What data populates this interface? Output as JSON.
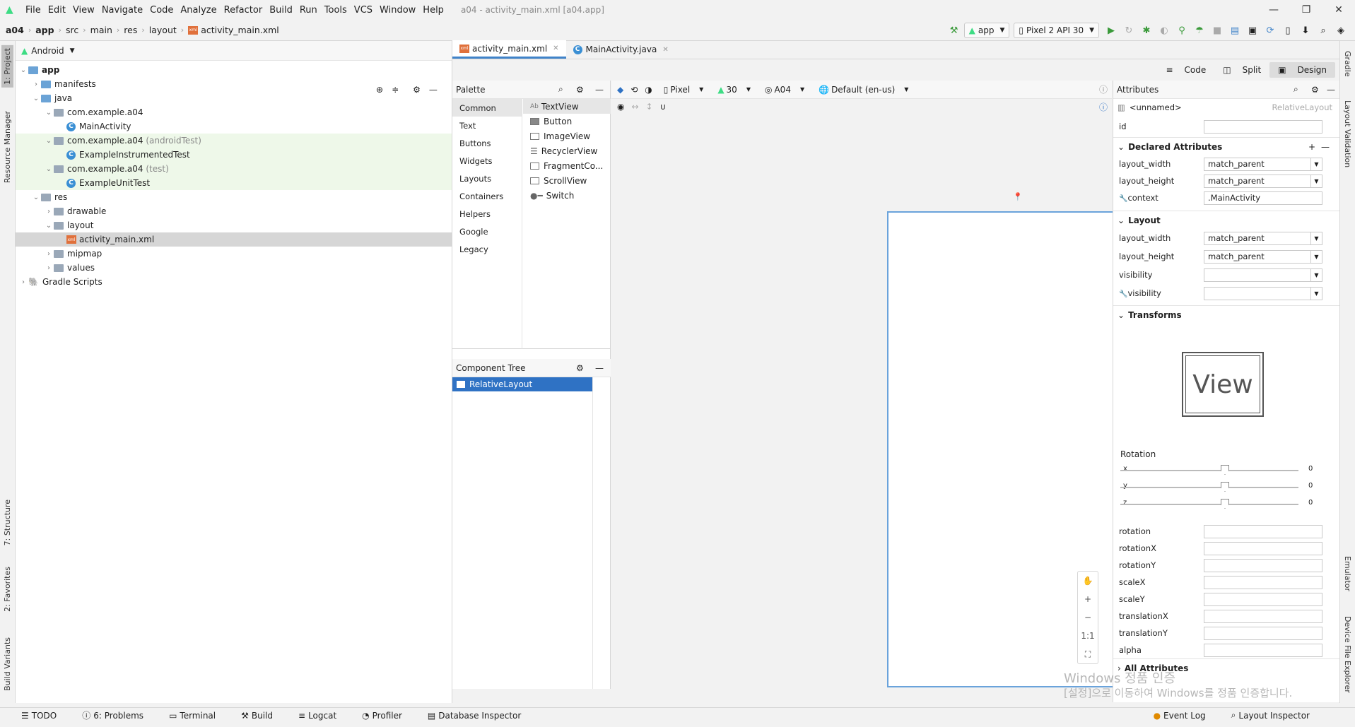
{
  "menu": [
    "File",
    "Edit",
    "View",
    "Navigate",
    "Code",
    "Analyze",
    "Refactor",
    "Build",
    "Run",
    "Tools",
    "VCS",
    "Window",
    "Help"
  ],
  "window_title": "a04 - activity_main.xml [a04.app]",
  "breadcrumb": [
    "a04",
    "app",
    "src",
    "main",
    "res",
    "layout",
    "activity_main.xml"
  ],
  "toolbar": {
    "run_config": "app",
    "device": "Pixel 2 API 30"
  },
  "left_tabs": {
    "project": "1: Project",
    "resource_manager": "Resource Manager",
    "structure": "7: Structure",
    "favorites": "2: Favorites",
    "build_variants": "Build Variants"
  },
  "right_tabs": {
    "gradle": "Gradle",
    "layout_validation": "Layout Validation",
    "emulator": "Emulator",
    "device_explorer": "Device File Explorer"
  },
  "project": {
    "view_label": "Android",
    "tree": [
      {
        "label": "app",
        "extra": ""
      },
      {
        "label": "manifests",
        "extra": ""
      },
      {
        "label": "java",
        "extra": ""
      },
      {
        "label": "com.example.a04",
        "extra": ""
      },
      {
        "label": "MainActivity",
        "extra": ""
      },
      {
        "label": "com.example.a04",
        "extra": "(androidTest)"
      },
      {
        "label": "ExampleInstrumentedTest",
        "extra": ""
      },
      {
        "label": "com.example.a04",
        "extra": "(test)"
      },
      {
        "label": "ExampleUnitTest",
        "extra": ""
      },
      {
        "label": "res",
        "extra": ""
      },
      {
        "label": "drawable",
        "extra": ""
      },
      {
        "label": "layout",
        "extra": ""
      },
      {
        "label": "activity_main.xml",
        "extra": ""
      },
      {
        "label": "mipmap",
        "extra": ""
      },
      {
        "label": "values",
        "extra": ""
      },
      {
        "label": "Gradle Scripts",
        "extra": ""
      }
    ]
  },
  "editor_tabs": [
    "activity_main.xml",
    "MainActivity.java"
  ],
  "view_modes": [
    "Code",
    "Split",
    "Design"
  ],
  "palette": {
    "title": "Palette",
    "categories": [
      "Common",
      "Text",
      "Buttons",
      "Widgets",
      "Layouts",
      "Containers",
      "Helpers",
      "Google",
      "Legacy"
    ],
    "items": [
      "TextView",
      "Button",
      "ImageView",
      "RecyclerView",
      "FragmentCo...",
      "ScrollView",
      "Switch"
    ]
  },
  "component_tree": {
    "title": "Component Tree",
    "root": "RelativeLayout"
  },
  "design_toolbar": {
    "device": "Pixel",
    "api": "30",
    "theme": "A04",
    "locale": "Default (en-us)"
  },
  "zoom": {
    "fit": "1:1"
  },
  "attributes": {
    "title": "Attributes",
    "component": "<unnamed>",
    "component_type": "RelativeLayout",
    "id_label": "id",
    "declared_title": "Declared Attributes",
    "declared": [
      {
        "k": "layout_width",
        "v": "match_parent"
      },
      {
        "k": "layout_height",
        "v": "match_parent"
      },
      {
        "k": "context",
        "v": ".MainActivity"
      }
    ],
    "layout_title": "Layout",
    "layout": [
      {
        "k": "layout_width",
        "v": "match_parent"
      },
      {
        "k": "layout_height",
        "v": "match_parent"
      },
      {
        "k": "visibility",
        "v": ""
      },
      {
        "k": "visibility",
        "v": ""
      }
    ],
    "transforms_title": "Transforms",
    "view_preview": "View",
    "rotation_title": "Rotation",
    "rotation": [
      {
        "axis": "x",
        "value": "0"
      },
      {
        "axis": "y",
        "value": "0"
      },
      {
        "axis": "z",
        "value": "0"
      }
    ],
    "transform_fields": [
      "rotation",
      "rotationX",
      "rotationY",
      "scaleX",
      "scaleY",
      "translationX",
      "translationY",
      "alpha"
    ],
    "all_attributes": "All Attributes"
  },
  "bottom_tools": [
    "TODO",
    "6: Problems",
    "Terminal",
    "Build",
    "Logcat",
    "Profiler",
    "Database Inspector"
  ],
  "bottom_right": [
    "Event Log",
    "Layout Inspector"
  ],
  "watermark": {
    "line1": "Windows 정품 인증",
    "line2": "[설정]으로 이동하여 Windows를 정품 인증합니다."
  }
}
